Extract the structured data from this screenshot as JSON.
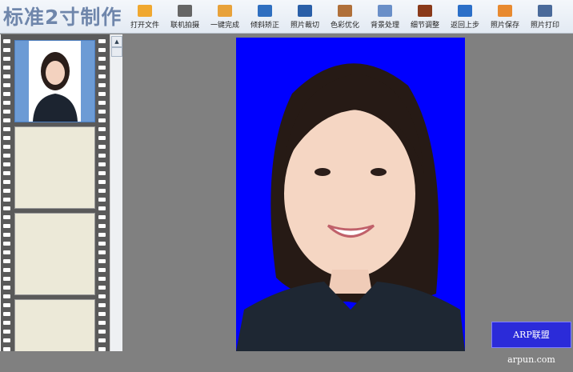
{
  "app": {
    "title": "标准2寸制作"
  },
  "toolbar": {
    "items": [
      {
        "label": "打开文件",
        "icon": "folder-icon"
      },
      {
        "label": "联机拍摄",
        "icon": "camera-icon"
      },
      {
        "label": "一键完成",
        "icon": "hand-icon"
      },
      {
        "label": "倾斜矫正",
        "icon": "rotate-icon"
      },
      {
        "label": "照片裁切",
        "icon": "crop-icon"
      },
      {
        "label": "色彩优化",
        "icon": "color-adjust-icon"
      },
      {
        "label": "背景处理",
        "icon": "brush-icon"
      },
      {
        "label": "细节调整",
        "icon": "histogram-icon"
      },
      {
        "label": "返回上步",
        "icon": "undo-icon"
      },
      {
        "label": "照片保存",
        "icon": "floppy-save-icon"
      },
      {
        "label": "照片打印",
        "icon": "printer-icon"
      }
    ]
  },
  "photo": {
    "background": "#0000ff"
  },
  "watermark": {
    "text": "ARP联盟 arpun.com"
  }
}
